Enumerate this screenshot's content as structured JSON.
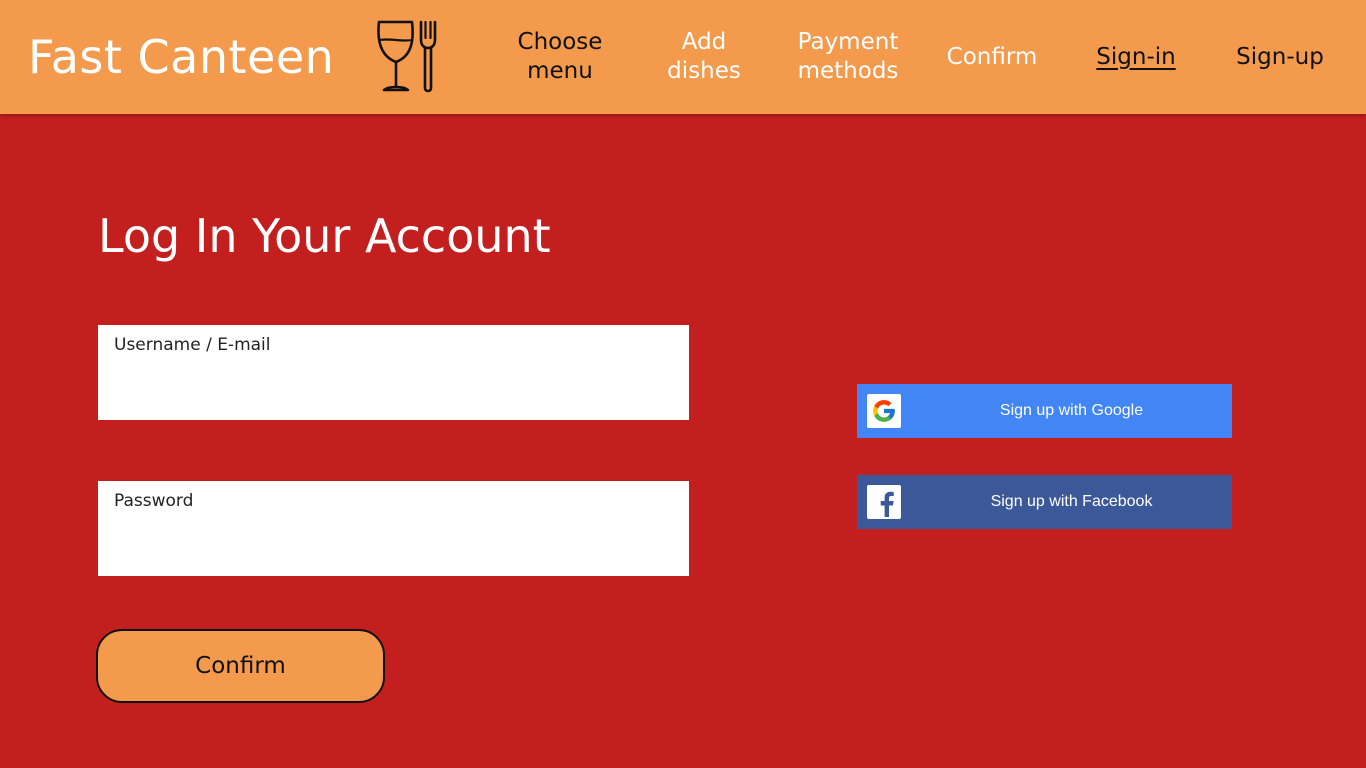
{
  "header": {
    "brand": "Fast Canteen",
    "logo_icon": "wine-glass-and-fork-icon",
    "background_color": "#f39a4d",
    "nav": [
      {
        "label": "Choose\nmenu",
        "style": "dark"
      },
      {
        "label": "Add\ndishes",
        "style": "light"
      },
      {
        "label": "Payment\nmethods",
        "style": "light"
      },
      {
        "label": "Confirm",
        "style": "light"
      },
      {
        "label": "Sign-in",
        "style": "dark",
        "active": true
      },
      {
        "label": "Sign-up",
        "style": "dark"
      }
    ]
  },
  "main": {
    "background_color": "#c41f1f",
    "title": "Log In Your Account",
    "fields": {
      "username": {
        "label": "Username / E-mail",
        "value": "",
        "placeholder": ""
      },
      "password": {
        "label": "Password",
        "value": "",
        "placeholder": ""
      }
    },
    "confirm_label": "Confirm"
  },
  "social": {
    "google": {
      "label": "Sign up with Google",
      "icon": "google-g-icon",
      "color": "#4285f4"
    },
    "facebook": {
      "label": "Sign up with Facebook",
      "icon": "facebook-f-icon",
      "color": "#3b5998"
    }
  }
}
